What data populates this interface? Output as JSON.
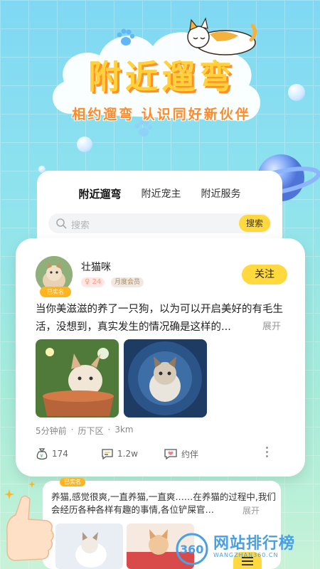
{
  "hero": {
    "title": "附近遛弯",
    "subtitle": "相约遛弯 认识同好新伙伴"
  },
  "tabs": [
    {
      "label": "附近遛弯",
      "active": true
    },
    {
      "label": "附近宠主",
      "active": false
    },
    {
      "label": "附近服务",
      "active": false
    }
  ],
  "search": {
    "placeholder": "搜索",
    "button_label": "搜索"
  },
  "post": {
    "username": "壮猫咪",
    "verified_label": "已实名",
    "age_badge": "24",
    "vip_badge": "月度会员",
    "follow_label": "关注",
    "text": "当你美滋滋的养了一只狗，以为可以开启美好的有毛生活，没想到，真实发生的情况确是这样的...",
    "expand_label": "展开",
    "time": "5分钟前",
    "district": "历下区",
    "distance": "3km",
    "likes": "174",
    "comments": "1.2w",
    "invite_label": "约伴"
  },
  "post2": {
    "text": "养猫,感觉很爽,一直养猫,一直爽……在养猫的过程中,我们会经历各种各样有趣的事情,各位铲屎官…",
    "expand_label": "展开",
    "verified_label": "已实名"
  },
  "watermark": {
    "logo_text": "360",
    "title": "网站排行榜",
    "url": "WANGZHAN360.CN"
  },
  "colors": {
    "accent_yellow": "#ffd93d",
    "title_yellow": "#ffd23a",
    "subtitle_orange": "#ff8a2a",
    "background_top": "#7fd8f3",
    "background_bottom": "#c8f2d8"
  },
  "icons": [
    "paw-icon",
    "search-icon",
    "like-money-bag-icon",
    "comment-icon",
    "heart-invite-icon",
    "more-vertical-icon"
  ]
}
